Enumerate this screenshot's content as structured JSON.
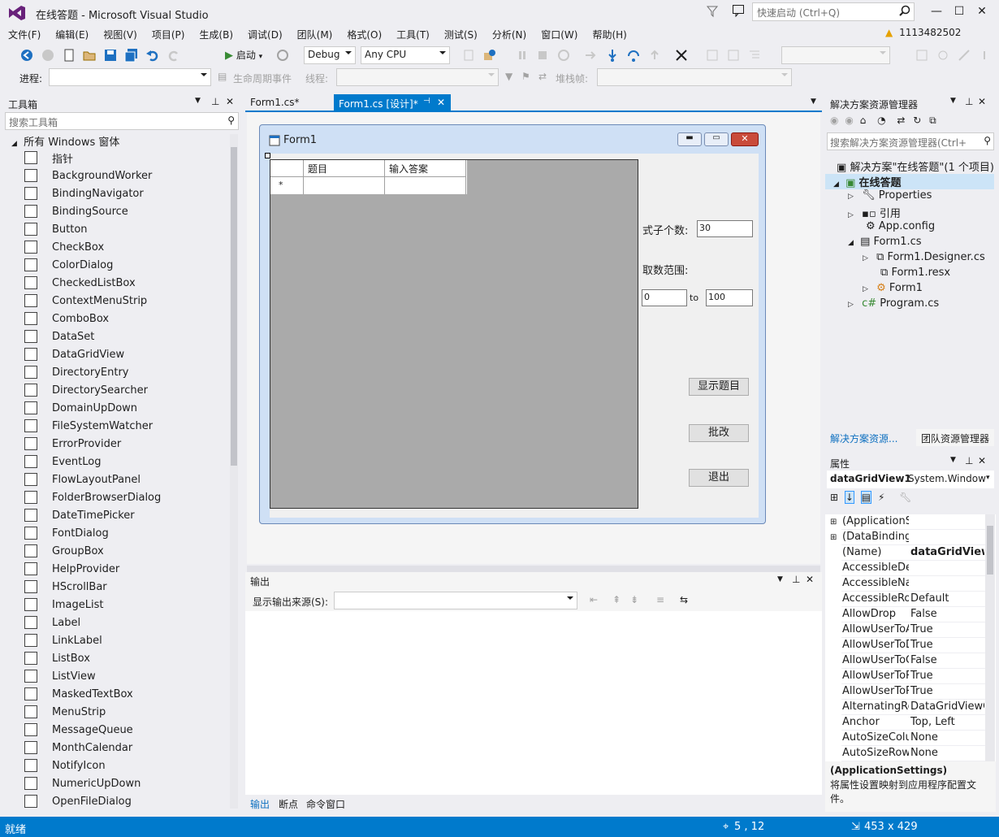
{
  "app": {
    "title": "在线答题 - Microsoft Visual Studio",
    "quick_launch_placeholder": "快速启动 (Ctrl+Q)",
    "account": "1113482502"
  },
  "colors": {
    "accent": "#007acc",
    "warning": "#e5a100",
    "vs_purple": "#68217a"
  },
  "menu": [
    "文件(F)",
    "编辑(E)",
    "视图(V)",
    "项目(P)",
    "生成(B)",
    "调试(D)",
    "团队(M)",
    "格式(O)",
    "工具(T)",
    "测试(S)",
    "分析(N)",
    "窗口(W)",
    "帮助(H)"
  ],
  "toolbar": {
    "start_label": "启动",
    "config": "Debug",
    "platform": "Any CPU"
  },
  "debug_toolbar": {
    "process_label": "进程:",
    "lifecycle_label": "生命周期事件",
    "thread_label": "线程:",
    "stackframe_label": "堆栈帧:"
  },
  "toolbox": {
    "title": "工具箱",
    "search_placeholder": "搜索工具箱",
    "group": "所有 Windows 窗体",
    "items": [
      "指针",
      "BackgroundWorker",
      "BindingNavigator",
      "BindingSource",
      "Button",
      "CheckBox",
      "ColorDialog",
      "CheckedListBox",
      "ContextMenuStrip",
      "ComboBox",
      "DataSet",
      "DataGridView",
      "DirectoryEntry",
      "DirectorySearcher",
      "DomainUpDown",
      "FileSystemWatcher",
      "ErrorProvider",
      "EventLog",
      "FlowLayoutPanel",
      "FolderBrowserDialog",
      "DateTimePicker",
      "FontDialog",
      "GroupBox",
      "HelpProvider",
      "HScrollBar",
      "ImageList",
      "Label",
      "LinkLabel",
      "ListBox",
      "ListView",
      "MaskedTextBox",
      "MenuStrip",
      "MessageQueue",
      "MonthCalendar",
      "NotifyIcon",
      "NumericUpDown",
      "OpenFileDialog"
    ]
  },
  "editor": {
    "tabs": [
      {
        "label": "Form1.cs*",
        "active": false
      },
      {
        "label": "Form1.cs [设计]*",
        "active": true
      }
    ]
  },
  "form": {
    "title": "Form1",
    "grid_columns": [
      "题目",
      "输入答案"
    ],
    "grid_new_row_marker": "*",
    "count_label": "式子个数:",
    "count_value": "30",
    "range_label": "取数范围:",
    "range_min": "0",
    "range_to": "to",
    "range_max": "100",
    "btn_show": "显示题目",
    "btn_check": "批改",
    "btn_exit": "退出"
  },
  "output": {
    "title": "输出",
    "source_label": "显示输出来源(S):",
    "bottom_tabs": [
      "输出",
      "断点",
      "命令窗口"
    ]
  },
  "solution_explorer": {
    "title": "解决方案资源管理器",
    "search_placeholder": "搜索解决方案资源管理器(Ctrl+",
    "nodes": [
      {
        "label": "解决方案\"在线答题\"(1 个项目)"
      },
      {
        "label": "在线答题"
      },
      {
        "label": "Properties"
      },
      {
        "label": "引用"
      },
      {
        "label": "App.config"
      },
      {
        "label": "Form1.cs"
      },
      {
        "label": "Form1.Designer.cs"
      },
      {
        "label": "Form1.resx"
      },
      {
        "label": "Form1"
      },
      {
        "label": "Program.cs"
      }
    ],
    "bottom_tabs": [
      "解决方案资源...",
      "团队资源管理器"
    ]
  },
  "properties": {
    "title": "属性",
    "object_name": "dataGridView1",
    "object_type": "System.Window",
    "rows": [
      {
        "name": "(ApplicationSe",
        "value": ""
      },
      {
        "name": "(DataBindings",
        "value": ""
      },
      {
        "name": "(Name)",
        "value": "dataGridView"
      },
      {
        "name": "AccessibleDes",
        "value": ""
      },
      {
        "name": "AccessibleNar",
        "value": ""
      },
      {
        "name": "AccessibleRol",
        "value": "Default"
      },
      {
        "name": "AllowDrop",
        "value": "False"
      },
      {
        "name": "AllowUserToA",
        "value": "True"
      },
      {
        "name": "AllowUserToD",
        "value": "True"
      },
      {
        "name": "AllowUserToC",
        "value": "False"
      },
      {
        "name": "AllowUserToR",
        "value": "True"
      },
      {
        "name": "AllowUserToR",
        "value": "True"
      },
      {
        "name": "AlternatingRo",
        "value": "DataGridViewC"
      },
      {
        "name": "Anchor",
        "value": "Top, Left"
      },
      {
        "name": "AutoSizeColur",
        "value": "None"
      },
      {
        "name": "AutoSizeRows",
        "value": "None"
      }
    ],
    "desc_title": "(ApplicationSettings)",
    "desc_text": "将属性设置映射到应用程序配置文件。"
  },
  "status": {
    "text": "就绪",
    "position": "5 , 12",
    "size": "453 x 429"
  }
}
